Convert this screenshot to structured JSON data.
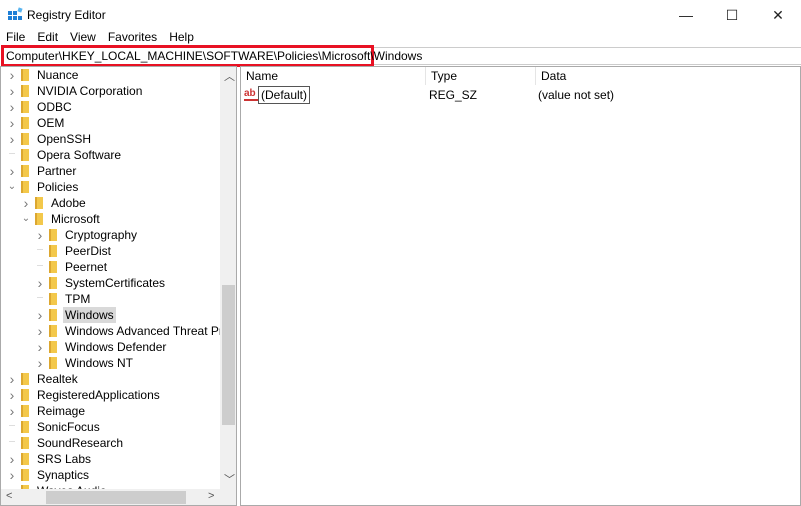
{
  "window": {
    "title": "Registry Editor",
    "minimize": "—",
    "maximize": "☐",
    "close": "✕"
  },
  "menu": [
    "File",
    "Edit",
    "View",
    "Favorites",
    "Help"
  ],
  "address": "Computer\\HKEY_LOCAL_MACHINE\\SOFTWARE\\Policies\\Microsoft\\Windows",
  "tree": [
    {
      "label": "Nuance",
      "level": 0,
      "arrow": ">"
    },
    {
      "label": "NVIDIA Corporation",
      "level": 0,
      "arrow": ">"
    },
    {
      "label": "ODBC",
      "level": 0,
      "arrow": ">"
    },
    {
      "label": "OEM",
      "level": 0,
      "arrow": ">"
    },
    {
      "label": "OpenSSH",
      "level": 0,
      "arrow": ">"
    },
    {
      "label": "Opera Software",
      "level": 0,
      "arrow": ""
    },
    {
      "label": "Partner",
      "level": 0,
      "arrow": ">"
    },
    {
      "label": "Policies",
      "level": 0,
      "arrow": "v"
    },
    {
      "label": "Adobe",
      "level": 1,
      "arrow": ">"
    },
    {
      "label": "Microsoft",
      "level": 1,
      "arrow": "v"
    },
    {
      "label": "Cryptography",
      "level": 2,
      "arrow": ">"
    },
    {
      "label": "PeerDist",
      "level": 2,
      "arrow": ""
    },
    {
      "label": "Peernet",
      "level": 2,
      "arrow": ""
    },
    {
      "label": "SystemCertificates",
      "level": 2,
      "arrow": ">"
    },
    {
      "label": "TPM",
      "level": 2,
      "arrow": ""
    },
    {
      "label": "Windows",
      "level": 2,
      "arrow": ">",
      "selected": true
    },
    {
      "label": "Windows Advanced Threat Protection",
      "level": 2,
      "arrow": ">"
    },
    {
      "label": "Windows Defender",
      "level": 2,
      "arrow": ">"
    },
    {
      "label": "Windows NT",
      "level": 2,
      "arrow": ">"
    },
    {
      "label": "Realtek",
      "level": 0,
      "arrow": ">"
    },
    {
      "label": "RegisteredApplications",
      "level": 0,
      "arrow": ">"
    },
    {
      "label": "Reimage",
      "level": 0,
      "arrow": ">"
    },
    {
      "label": "SonicFocus",
      "level": 0,
      "arrow": ""
    },
    {
      "label": "SoundResearch",
      "level": 0,
      "arrow": ""
    },
    {
      "label": "SRS Labs",
      "level": 0,
      "arrow": ">"
    },
    {
      "label": "Synaptics",
      "level": 0,
      "arrow": ">"
    },
    {
      "label": "Waves Audio",
      "level": 0,
      "arrow": ">"
    }
  ],
  "list": {
    "columns": [
      "Name",
      "Type",
      "Data"
    ],
    "rows": [
      {
        "icon": "string-value-icon",
        "icon_text": "ab",
        "name": "(Default)",
        "type": "REG_SZ",
        "data": "(value not set)"
      }
    ]
  }
}
